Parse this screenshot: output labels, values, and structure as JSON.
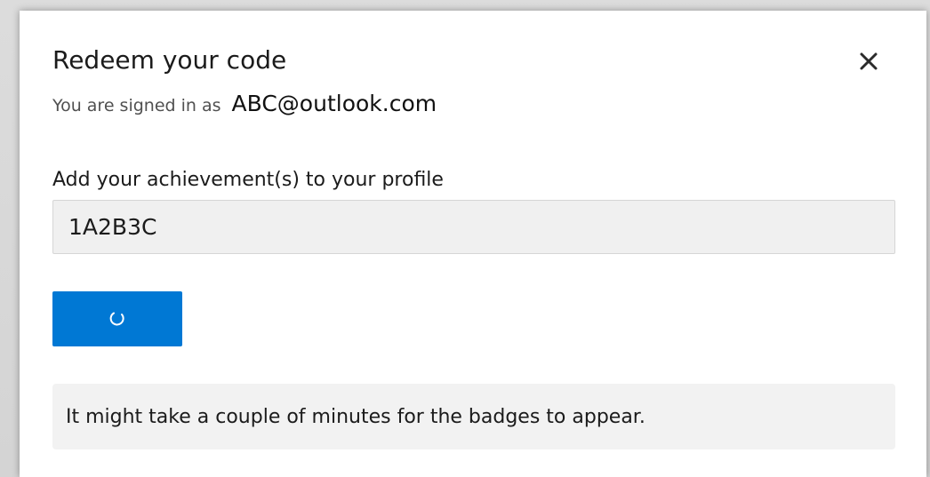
{
  "dialog": {
    "title": "Redeem your code",
    "close_icon": "close-icon",
    "signed_in_prefix": "You are signed in as",
    "signed_in_email": "ABC@outlook.com"
  },
  "form": {
    "label": "Add your achievement(s) to your profile",
    "code_value": "1A2B3C",
    "submit_state_icon": "loading-spinner-icon"
  },
  "notice": {
    "text": "It might take a couple of minutes for the badges to appear."
  },
  "colors": {
    "accent": "#0078d4",
    "input_background": "#f0f0f0",
    "notice_background": "#f2f2f2"
  }
}
